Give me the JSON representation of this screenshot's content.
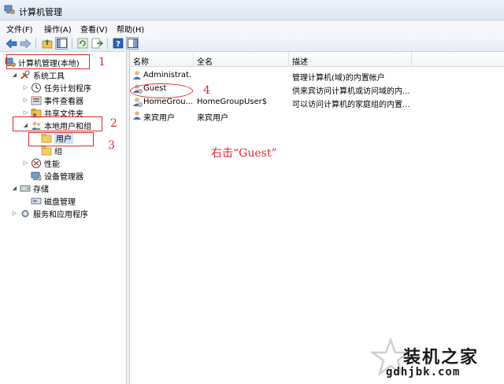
{
  "window": {
    "title": "计算机管理"
  },
  "menu": [
    "文件(F)",
    "操作(A)",
    "查看(V)",
    "帮助(H)"
  ],
  "toolbar": {
    "buttons": [
      "back-icon",
      "forward-icon",
      "up-folder-icon",
      "show-hide-tree-icon",
      "refresh-icon",
      "export-icon",
      "help-icon",
      "properties-icon"
    ]
  },
  "tree": [
    {
      "label": "计算机管理(本地)",
      "icon": "computer-management-icon",
      "selected": false
    },
    {
      "label": "系统工具",
      "icon": "tools-icon",
      "toggle": "expanded"
    },
    {
      "label": "任务计划程序",
      "icon": "clock-icon",
      "toggle": "collapsed"
    },
    {
      "label": "事件查看器",
      "icon": "event-viewer-icon",
      "toggle": "collapsed"
    },
    {
      "label": "共享文件夹",
      "icon": "shared-folder-icon",
      "toggle": "collapsed"
    },
    {
      "label": "本地用户和组",
      "icon": "users-group-icon",
      "toggle": "expanded"
    },
    {
      "label": "用户",
      "icon": "folder-icon",
      "selected": true
    },
    {
      "label": "组",
      "icon": "folder-icon"
    },
    {
      "label": "性能",
      "icon": "performance-icon",
      "toggle": "collapsed"
    },
    {
      "label": "设备管理器",
      "icon": "device-manager-icon"
    },
    {
      "label": "存储",
      "icon": "storage-icon",
      "toggle": "expanded"
    },
    {
      "label": "磁盘管理",
      "icon": "disk-icon"
    },
    {
      "label": "服务和应用程序",
      "icon": "services-icon",
      "toggle": "collapsed"
    }
  ],
  "list": {
    "columns": [
      "名称",
      "全名",
      "描述"
    ],
    "rows": [
      {
        "name": "Administrat...",
        "full_name": "",
        "description": "管理计算机(域)的内置帐户"
      },
      {
        "name": "Guest",
        "full_name": "",
        "description": "供来宾访问计算机或访问域的内..."
      },
      {
        "name": "HomeGrou...",
        "full_name": "HomeGroupUser$",
        "description": "可以访问计算机的家庭组的内置..."
      },
      {
        "name": "来宾用户",
        "full_name": "来宾用户",
        "description": ""
      }
    ]
  },
  "annotations": {
    "step1": "1",
    "step2": "2",
    "step3": "3",
    "step4": "4",
    "instruction": "右击“Guest”",
    "color": "#e0262a"
  },
  "watermark": {
    "brand": "装机之家",
    "url": "gdhjbk.com"
  }
}
